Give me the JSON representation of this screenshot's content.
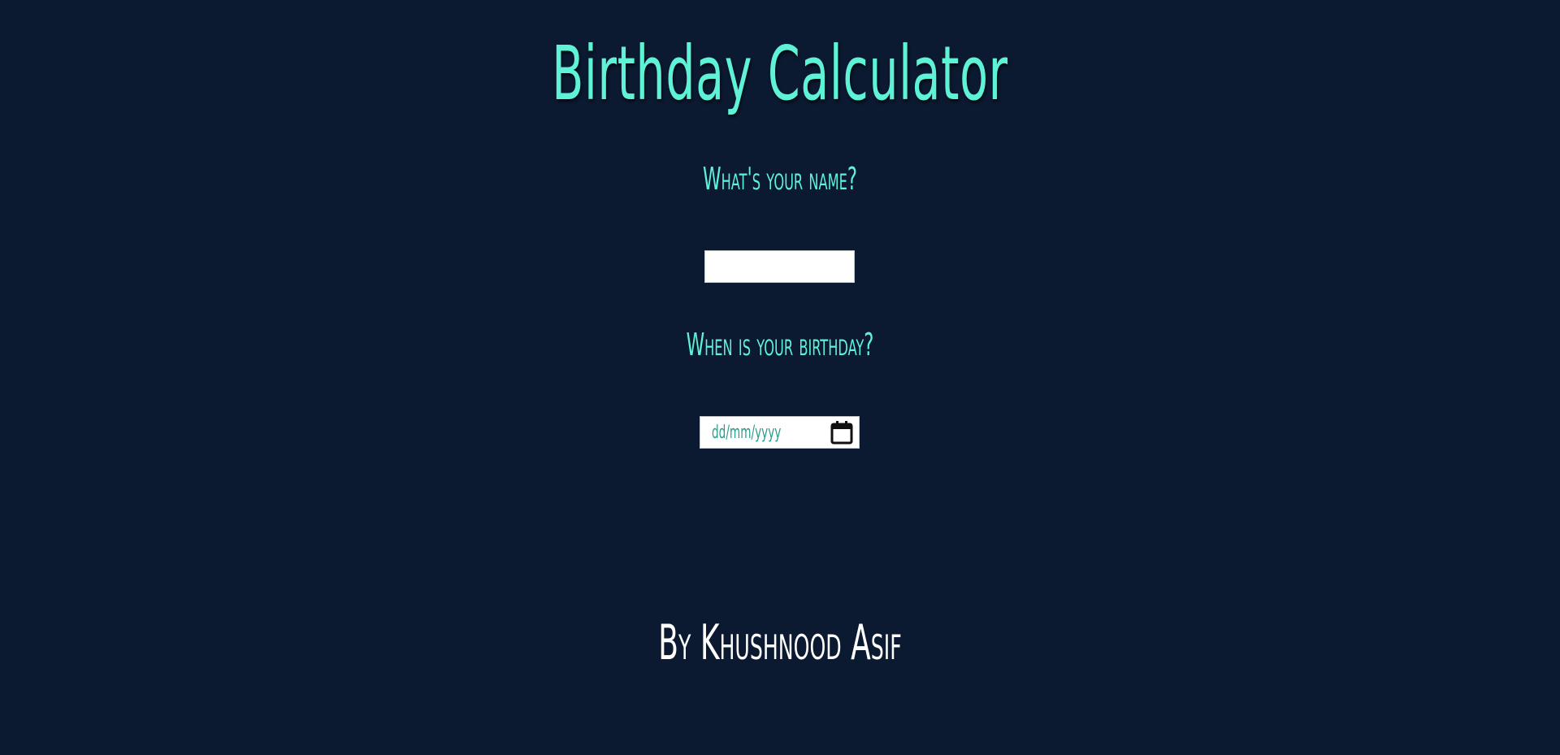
{
  "header": {
    "title": "Birthday Calculator"
  },
  "form": {
    "name_label": "What's your name?",
    "name_value": "",
    "birthday_label": "When is your birthday?",
    "date_placeholder": "dd/mm/yyyy",
    "calendar_icon": "calendar-icon"
  },
  "footer": {
    "credit": "By Khushnood Asif"
  },
  "colors": {
    "background": "#0b1931",
    "accent": "#5ef2d6",
    "footer_text": "#ffffff"
  }
}
